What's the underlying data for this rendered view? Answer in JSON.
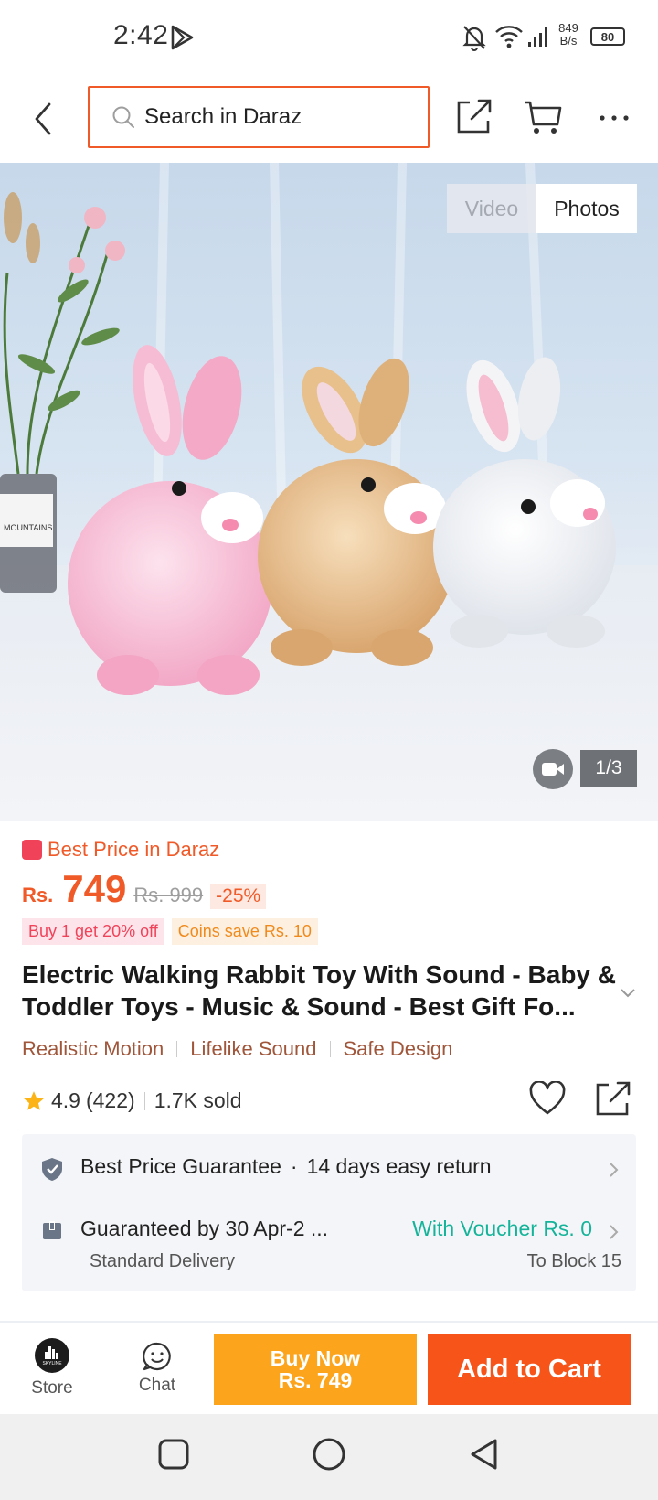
{
  "status_bar": {
    "time": "2:42",
    "net_speed_value": "849",
    "net_speed_unit": "B/s",
    "battery": "80"
  },
  "header": {
    "search_placeholder": "Search in Daraz"
  },
  "gallery": {
    "tab_video": "Video",
    "tab_photos": "Photos",
    "counter": "1/3",
    "vase_label": "MOUNTAINS"
  },
  "product": {
    "best_price_label": "Best Price in Daraz",
    "currency": "Rs.",
    "price": "749",
    "original_price": "Rs. 999",
    "discount": "-25%",
    "promos": [
      "Buy 1 get 20% off",
      "Coins save Rs. 10"
    ],
    "title": "Electric Walking Rabbit Toy With Sound - Baby & Toddler Toys - Music & Sound - Best Gift Fo...",
    "features": [
      "Realistic Motion",
      "Lifelike Sound",
      "Safe Design"
    ],
    "rating": "4.9",
    "reviews": "(422)",
    "sold": "1.7K sold",
    "rating_value": 4.9
  },
  "services": {
    "guarantee": "Best Price Guarantee",
    "separator": "·",
    "returns": "14 days easy return",
    "delivery": "Guaranteed by 30 Apr-2 ...",
    "voucher": "With Voucher Rs. 0",
    "delivery_type": "Standard Delivery",
    "destination": "To Block 15"
  },
  "bottom_bar": {
    "store_label": "Store",
    "chat_label": "Chat",
    "buy_now_line1": "Buy Now",
    "buy_now_line2": "Rs. 749",
    "add_to_cart": "Add to Cart",
    "store_logo_text": "SKYLINE"
  },
  "colors": {
    "accent": "#f05a28",
    "buy_now": "#fca41c",
    "add_to_cart": "#f7541a",
    "voucher_green": "#15b49a"
  }
}
